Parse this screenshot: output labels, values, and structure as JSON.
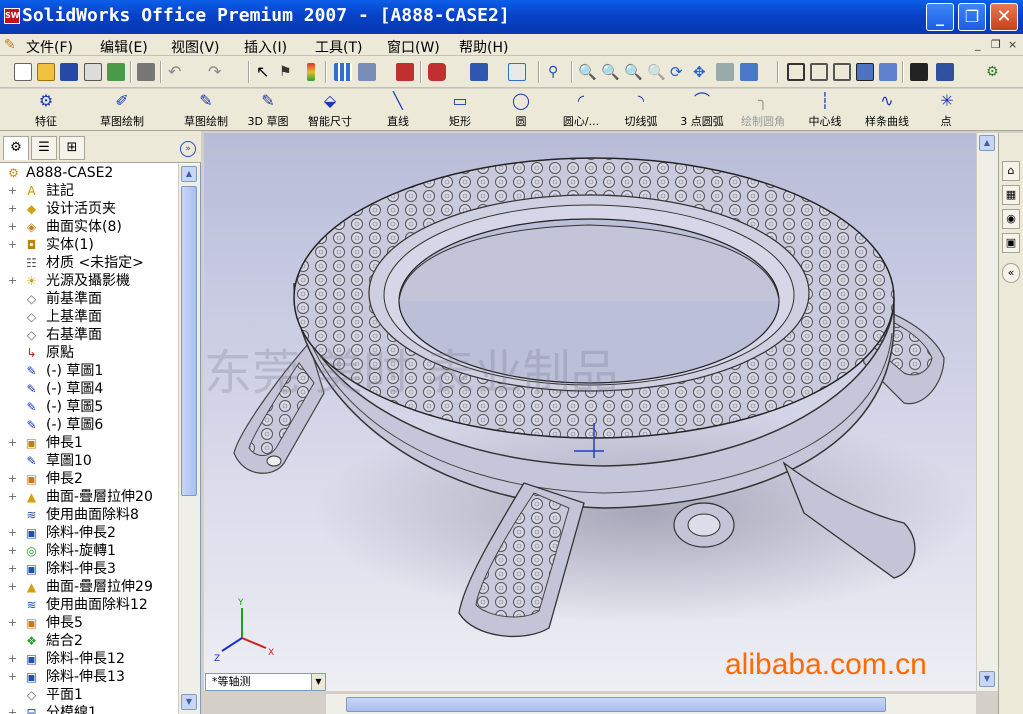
{
  "window": {
    "title": "SolidWorks Office Premium 2007 - [A888-CASE2]",
    "app_icon_text": "SW",
    "controls": {
      "minimize": "_",
      "maximize": "❐",
      "close": "✕"
    }
  },
  "menubar": {
    "items": [
      "文件(F)",
      "编辑(E)",
      "视图(V)",
      "插入(I)",
      "工具(T)",
      "窗口(W)",
      "帮助(H)"
    ],
    "doc_controls": [
      "_",
      "❐",
      "×"
    ]
  },
  "command_toolbar": {
    "items": [
      {
        "label": "特征",
        "icon": "feature-icon"
      },
      {
        "label": "草图绘制",
        "icon": "sketch-icon"
      },
      {
        "label": "草图绘制",
        "icon": "sketch-icon"
      },
      {
        "label": "3D 草图",
        "icon": "3d-sketch-icon"
      },
      {
        "label": "智能尺寸",
        "icon": "smart-dimension-icon"
      },
      {
        "label": "直线",
        "icon": "line-icon"
      },
      {
        "label": "矩形",
        "icon": "rectangle-icon"
      },
      {
        "label": "圆",
        "icon": "circle-icon"
      },
      {
        "label": "圆心/...",
        "icon": "centerpoint-arc-icon"
      },
      {
        "label": "切线弧",
        "icon": "tangent-arc-icon"
      },
      {
        "label": "3 点圆弧",
        "icon": "three-point-arc-icon"
      },
      {
        "label": "绘制圆角",
        "icon": "sketch-fillet-icon",
        "disabled": true
      },
      {
        "label": "中心线",
        "icon": "centerline-icon"
      },
      {
        "label": "样条曲线",
        "icon": "spline-icon"
      },
      {
        "label": "点",
        "icon": "point-icon"
      }
    ]
  },
  "feature_manager": {
    "root": "A888-CASE2",
    "items": [
      {
        "label": "註記",
        "icon": "annotations-icon",
        "expandable": true
      },
      {
        "label": "设计活页夹",
        "icon": "design-binder-icon",
        "expandable": true
      },
      {
        "label": "曲面实体(8)",
        "icon": "surface-bodies-icon",
        "expandable": true
      },
      {
        "label": "实体(1)",
        "icon": "solid-bodies-icon",
        "expandable": true
      },
      {
        "label": "材质 <未指定>",
        "icon": "material-icon",
        "expandable": false
      },
      {
        "label": "光源及攝影機",
        "icon": "lights-cameras-icon",
        "expandable": true
      },
      {
        "label": "前基準面",
        "icon": "plane-icon",
        "expandable": false
      },
      {
        "label": "上基準面",
        "icon": "plane-icon",
        "expandable": false
      },
      {
        "label": "右基準面",
        "icon": "plane-icon",
        "expandable": false
      },
      {
        "label": "原點",
        "icon": "origin-icon",
        "expandable": false
      },
      {
        "label": "(-) 草圖1",
        "icon": "sketch-icon",
        "expandable": false
      },
      {
        "label": "(-) 草圖4",
        "icon": "sketch-icon",
        "expandable": false
      },
      {
        "label": "(-) 草圖5",
        "icon": "sketch-icon",
        "expandable": false
      },
      {
        "label": "(-) 草圖6",
        "icon": "sketch-icon",
        "expandable": false
      },
      {
        "label": "伸長1",
        "icon": "extrude-icon",
        "expandable": true
      },
      {
        "label": "草圖10",
        "icon": "sketch-icon",
        "expandable": false
      },
      {
        "label": "伸長2",
        "icon": "extrude-icon",
        "expandable": true
      },
      {
        "label": "曲面-疊層拉伸20",
        "icon": "surface-loft-icon",
        "expandable": true
      },
      {
        "label": "使用曲面除料8",
        "icon": "surface-cut-icon",
        "expandable": false
      },
      {
        "label": "除料-伸長2",
        "icon": "cut-extrude-icon",
        "expandable": true
      },
      {
        "label": "除料-旋轉1",
        "icon": "cut-revolve-icon",
        "expandable": true
      },
      {
        "label": "除料-伸長3",
        "icon": "cut-extrude-icon",
        "expandable": true
      },
      {
        "label": "曲面-疊層拉伸29",
        "icon": "surface-loft-icon",
        "expandable": true
      },
      {
        "label": "使用曲面除料12",
        "icon": "surface-cut-icon",
        "expandable": false
      },
      {
        "label": "伸長5",
        "icon": "extrude-icon",
        "expandable": true
      },
      {
        "label": "結合2",
        "icon": "combine-icon",
        "expandable": false
      },
      {
        "label": "除料-伸長12",
        "icon": "cut-extrude-icon",
        "expandable": true
      },
      {
        "label": "除料-伸長13",
        "icon": "cut-extrude-icon",
        "expandable": true
      },
      {
        "label": "平面1",
        "icon": "plane-icon",
        "expandable": false
      },
      {
        "label": "分模線1",
        "icon": "split-line-icon",
        "expandable": true
      }
    ]
  },
  "viewport": {
    "watermark": "东莞 美时 表业制品",
    "view_orientation": "*等轴测",
    "triad_labels": {
      "x": "X",
      "y": "Y",
      "z": "Z"
    }
  },
  "overlay": {
    "site": "alibaba.com.cn",
    "color": "#ff6a00"
  },
  "colors": {
    "titlebar": "#0842c8",
    "model": "#c8c8dc",
    "viewport_top": "#b8bcd8"
  }
}
